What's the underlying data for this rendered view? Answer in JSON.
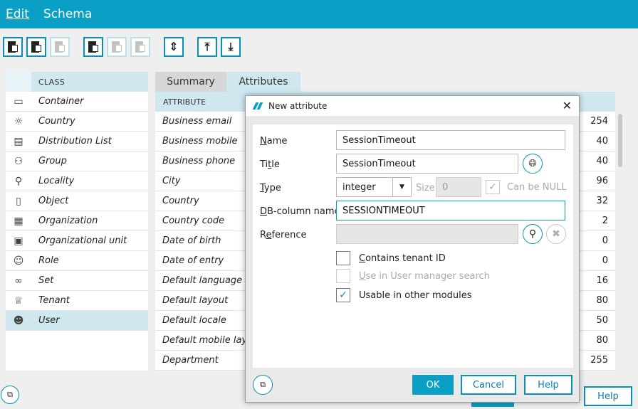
{
  "menu": {
    "items": [
      {
        "label": "Edit"
      },
      {
        "label": "Schema"
      }
    ]
  },
  "classes": {
    "header": "CLASS",
    "items": [
      {
        "label": "Container",
        "icon": "folder-icon"
      },
      {
        "label": "Country",
        "icon": "country-icon"
      },
      {
        "label": "Distribution List",
        "icon": "distribution-list-icon"
      },
      {
        "label": "Group",
        "icon": "group-icon"
      },
      {
        "label": "Locality",
        "icon": "locality-pin-icon"
      },
      {
        "label": "Object",
        "icon": "object-icon"
      },
      {
        "label": "Organization",
        "icon": "organization-building-icon"
      },
      {
        "label": "Organizational unit",
        "icon": "organizational-unit-icon"
      },
      {
        "label": "Role",
        "icon": "role-icon"
      },
      {
        "label": "Set",
        "icon": "set-icon"
      },
      {
        "label": "Tenant",
        "icon": "tenant-crown-icon"
      },
      {
        "label": "User",
        "icon": "user-icon",
        "selected": true
      }
    ]
  },
  "tabs": [
    {
      "label": "Summary"
    },
    {
      "label": "Attributes",
      "active": true
    }
  ],
  "attributes": {
    "header": "ATTRIBUTE",
    "rows": [
      {
        "name": "Business email",
        "length": "254"
      },
      {
        "name": "Business mobile",
        "length": "40"
      },
      {
        "name": "Business phone",
        "length": "40"
      },
      {
        "name": "City",
        "length": "96"
      },
      {
        "name": "Country",
        "length": "32"
      },
      {
        "name": "Country code",
        "length": "2"
      },
      {
        "name": "Date of birth",
        "length": "0"
      },
      {
        "name": "Date of entry",
        "length": "0"
      },
      {
        "name": "Default language",
        "length": "16"
      },
      {
        "name": "Default layout",
        "length": "80"
      },
      {
        "name": "Default locale",
        "length": "50"
      },
      {
        "name": "Default mobile layout",
        "length": "80"
      },
      {
        "name": "Department",
        "length": "255"
      }
    ]
  },
  "main_footer": {
    "help_label": "Help"
  },
  "dialog": {
    "title": "New attribute",
    "name_label_u": "N",
    "name_label_rest": "ame",
    "name_value": "SessionTimeout",
    "title_label_pre": "Ti",
    "title_label_u": "t",
    "title_label_rest": "le",
    "title_value": "SessionTimeout",
    "type_label_u": "T",
    "type_label_rest": "ype",
    "type_value": "integer",
    "size_label": "Size",
    "size_value": "0",
    "null_label": "Can be NULL",
    "dbcolumn_label_u": "D",
    "dbcolumn_label_rest": "B-column name",
    "dbcolumn_value": "SESSIONTIMEOUT",
    "reference_label_pre": "R",
    "reference_label_u": "e",
    "reference_label_rest": "ference",
    "reference_value": "",
    "checkboxes": [
      {
        "label_u": "C",
        "label_rest": "ontains tenant ID",
        "checked": false,
        "disabled": false
      },
      {
        "label_u": "U",
        "label_rest": "se in User manager search",
        "checked": false,
        "disabled": true
      },
      {
        "label_u": "",
        "label_rest": "Usable in other modules",
        "checked": true,
        "disabled": false
      }
    ],
    "ok_label": "OK",
    "cancel_label": "Cancel",
    "help_label": "Help"
  },
  "colors": {
    "accent": "#0a9fc4",
    "selection": "#cfe8f0"
  }
}
